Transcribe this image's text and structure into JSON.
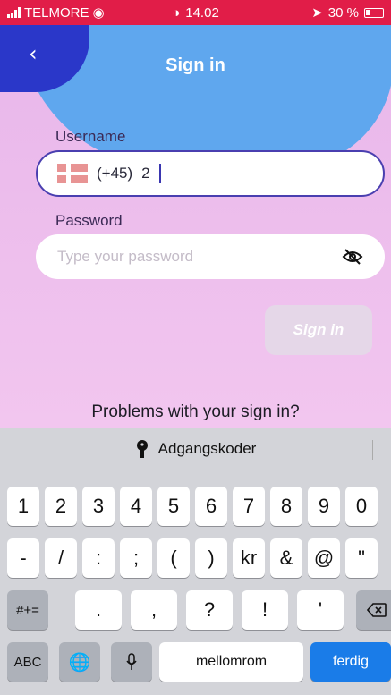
{
  "status_bar": {
    "carrier": "TELMORE",
    "time": "14.02",
    "battery": "30 %"
  },
  "header": {
    "title": "Sign in",
    "back_icon": "chevron-left-icon"
  },
  "form": {
    "username_label": "Username",
    "country_code": "(+45)",
    "username_value": "2",
    "password_label": "Password",
    "password_placeholder": "Type your password",
    "signin_label": "Sign in",
    "problems_text": "Problems with your sign in?"
  },
  "keyboard": {
    "suggestion": "Adgangskoder",
    "row1": [
      "1",
      "2",
      "3",
      "4",
      "5",
      "6",
      "7",
      "8",
      "9",
      "0"
    ],
    "row2": [
      "-",
      "/",
      ":",
      ";",
      "(",
      ")",
      "kr",
      "&",
      "@",
      "\""
    ],
    "row3_left": "#+=",
    "row3": [
      ".",
      ",",
      "?",
      "!",
      "'"
    ],
    "abc": "ABC",
    "space": "mellomrom",
    "done": "ferdig"
  },
  "colors": {
    "status_bar": "#e11d48",
    "accent": "#4a3fb0",
    "done_key": "#1a7ce8"
  }
}
